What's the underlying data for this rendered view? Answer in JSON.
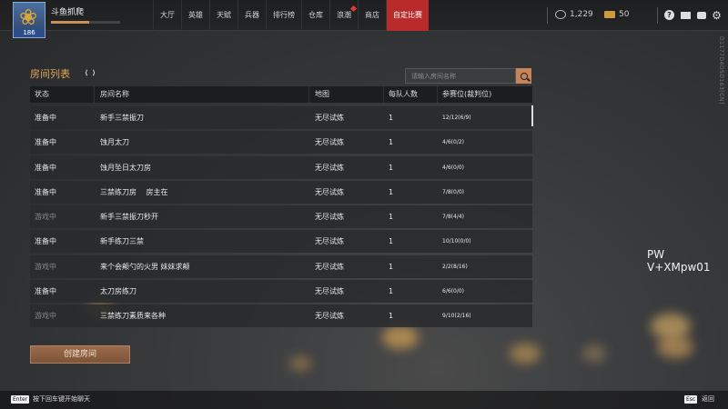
{
  "header": {
    "username": "斗鱼抓爬",
    "level": "186",
    "exp_fraction": 0.55,
    "nav": [
      {
        "label": "大厅",
        "active": false,
        "badge": false
      },
      {
        "label": "英雄",
        "active": false,
        "badge": false
      },
      {
        "label": "天赋",
        "active": false,
        "badge": false
      },
      {
        "label": "兵器",
        "active": false,
        "badge": false
      },
      {
        "label": "排行榜",
        "active": false,
        "badge": false
      },
      {
        "label": "仓库",
        "active": false,
        "badge": false
      },
      {
        "label": "浪潮",
        "active": false,
        "badge": true
      },
      {
        "label": "商店",
        "active": false,
        "badge": false
      },
      {
        "label": "自定比赛",
        "active": true,
        "badge": false
      }
    ],
    "coins": "1,229",
    "gold": "50",
    "accent": "#b92b2b"
  },
  "side_code": "D1177D4D5D163[CN]",
  "room_list": {
    "title": "房间列表",
    "search_placeholder": "请输入房间名称",
    "columns": [
      "状态",
      "房间名称",
      "地图",
      "每队人数",
      "参赛位(裁判位)"
    ],
    "rows": [
      {
        "status": "准备中",
        "name": "新手三禁振刀",
        "map": "无尽试炼",
        "team": "1",
        "slots": "12/12(6/9)",
        "in_game": false
      },
      {
        "status": "准备中",
        "name": "蚀月太刀",
        "map": "无尽试炼",
        "team": "1",
        "slots": "4/6(0/2)",
        "in_game": false
      },
      {
        "status": "准备中",
        "name": "蚀月坠日太刀房",
        "map": "无尽试炼",
        "team": "1",
        "slots": "4/6(0/0)",
        "in_game": false
      },
      {
        "status": "准备中",
        "name": "三禁练刀房　 房主在",
        "map": "无尽试炼",
        "team": "1",
        "slots": "7/8(0/0)",
        "in_game": false
      },
      {
        "status": "游戏中",
        "name": "新手三禁振刀秒开",
        "map": "无尽试炼",
        "team": "1",
        "slots": "7/8(4/4)",
        "in_game": true
      },
      {
        "status": "准备中",
        "name": "新手练刀三禁",
        "map": "无尽试炼",
        "team": "1",
        "slots": "10/10(0/0)",
        "in_game": false
      },
      {
        "status": "游戏中",
        "name": "来个会颠勺的火男 妹妹求颠",
        "map": "无尽试炼",
        "team": "1",
        "slots": "2/2(8/16)",
        "in_game": true
      },
      {
        "status": "准备中",
        "name": "太刀房练刀",
        "map": "无尽试炼",
        "team": "1",
        "slots": "6/6(0/0)",
        "in_game": false
      },
      {
        "status": "游戏中",
        "name": "三禁练刀素质来各种",
        "map": "无尽试炼",
        "team": "1",
        "slots": "9/10(2/16)",
        "in_game": true
      }
    ],
    "create_button": "创建房间"
  },
  "overlay": "PW V+XMpw01",
  "footer": {
    "enter_key": "Enter",
    "enter_hint": "按下回车键开始聊天",
    "esc_key": "Esc",
    "esc_hint": "返回"
  }
}
